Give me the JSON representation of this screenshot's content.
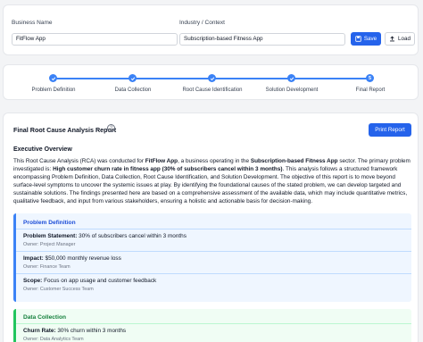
{
  "form": {
    "business_label": "Business Name",
    "business_value": "FitFlow App",
    "industry_label": "Industry / Context",
    "industry_value": "Subscription-based Fitness App",
    "save_label": "Save",
    "load_label": "Load"
  },
  "stepper": {
    "steps": [
      {
        "label": "Problem Definition",
        "status": "complete"
      },
      {
        "label": "Data Collection",
        "status": "complete"
      },
      {
        "label": "Root Cause Identification",
        "status": "complete"
      },
      {
        "label": "Solution Development",
        "status": "complete"
      },
      {
        "label": "Final Report",
        "status": "current",
        "number": "5"
      }
    ]
  },
  "report": {
    "title": "Final Root Cause Analysis Report",
    "print_label": "Print Report",
    "executive_heading": "Executive Overview",
    "executive": {
      "t1": "This Root Cause Analysis (RCA) was conducted for ",
      "b1": "FitFlow App",
      "t2": ", a business operating in the ",
      "b2": "Subscription-based Fitness App",
      "t3": " sector. The primary problem investigated is: ",
      "b3": "High customer churn rate in fitness app (30% of subscribers cancel within 3 months)",
      "t4": ". This analysis follows a structured framework encompassing Problem Definition, Data Collection, Root Cause Identification, and Solution Development. The objective of this report is to move beyond surface-level symptoms to uncover the systemic issues at play. By identifying the foundational causes of the stated problem, we can develop targeted and sustainable solutions. The findings presented here are based on a comprehensive assessment of the available data, which may include quantitative metrics, qualitative feedback, and input from various stakeholders, ensuring a holistic and actionable basis for decision-making."
    },
    "problem_definition": {
      "title": "Problem Definition",
      "items": [
        {
          "key": "Problem Statement:",
          "value": " 30% of subscribers cancel within 3 months",
          "owner": "Owner: Project Manager"
        },
        {
          "key": "Impact:",
          "value": " $50,000 monthly revenue loss",
          "owner": "Owner: Finance Team"
        },
        {
          "key": "Scope:",
          "value": " Focus on app usage and customer feedback",
          "owner": "Owner: Customer Success Team"
        }
      ]
    },
    "data_collection": {
      "title": "Data Collection",
      "items": [
        {
          "key": "Churn Rate:",
          "value": " 30% churn within 3 months",
          "owner": "Owner: Data Analytics Team"
        }
      ]
    }
  },
  "colors": {
    "accent": "#2563eb",
    "step": "#3b82f6",
    "problem_box": "#eff6ff",
    "data_box": "#f0fdf4"
  }
}
